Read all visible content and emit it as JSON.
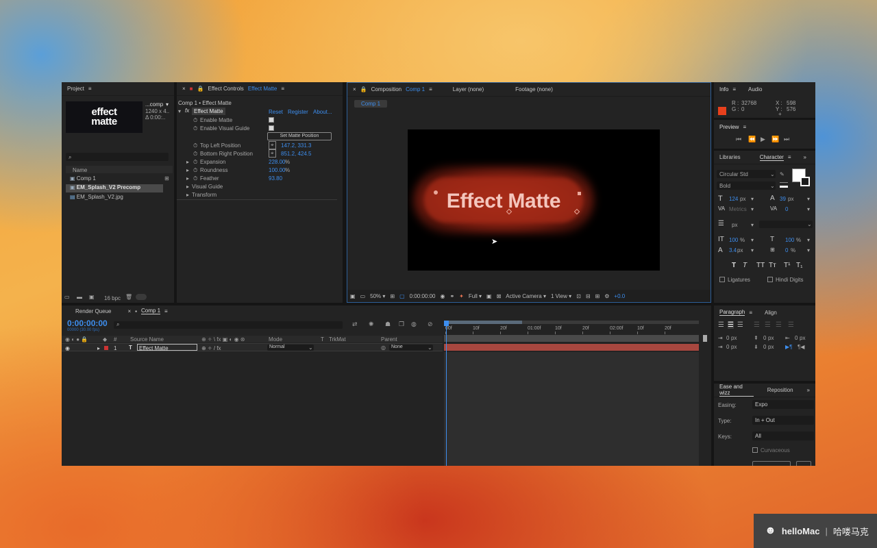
{
  "project": {
    "title": "Project",
    "thumb_line1": "effect",
    "thumb_line2": "matte",
    "thumb_caption": "...comp",
    "thumb_size": "1240 x 4..",
    "thumb_delta": "Δ 0:00:..",
    "search_icon": "magnify-icon",
    "col_name": "Name",
    "items": [
      {
        "label": "Comp 1",
        "icon": "comp-icon"
      },
      {
        "label": "EM_Splash_V2 Precomp",
        "icon": "comp-icon"
      },
      {
        "label": "EM_Splash_V2.jpg",
        "icon": "image-icon"
      }
    ],
    "bpc": "16 bpc"
  },
  "effect_controls": {
    "title_prefix": "Effect Controls",
    "title_layer": "Effect Matte",
    "breadcrumb": "Comp 1 • Effect Matte",
    "effect_name": "Effect Matte",
    "reset": "Reset",
    "register": "Register",
    "about": "About...",
    "enable_matte": "Enable Matte",
    "enable_visual_guide": "Enable Visual Guide",
    "set_matte_position": "Set Matte Position",
    "top_left": "Top Left Position",
    "top_left_value": "147.2, 331.3",
    "bottom_right": "Bottom Right Position",
    "bottom_right_value": "851.2, 424.5",
    "expansion": "Expansion",
    "expansion_value": "228.00",
    "expansion_unit": "%",
    "roundness": "Roundness",
    "roundness_value": "100.00",
    "roundness_unit": "%",
    "feather": "Feather",
    "feather_value": "93.80",
    "visual_guide": "Visual Guide",
    "transform": "Transform"
  },
  "composition": {
    "tab_prefix": "Composition",
    "tab_comp": "Comp 1",
    "layer_tab": "Layer (none)",
    "footage_tab": "Footage (none)",
    "comp_chip": "Comp 1",
    "canvas_text": "Effect Matte",
    "zoom": "50%",
    "timecode": "0:00:00:00",
    "resolution": "Full",
    "camera": "Active Camera",
    "views": "1 View",
    "exposure": "+0.0"
  },
  "info": {
    "tab_info": "Info",
    "tab_audio": "Audio",
    "r_label": "R :",
    "r_value": "32768",
    "g_label": "G :",
    "g_value": "0",
    "x_label": "X :",
    "x_value": "598",
    "y_label": "Y :",
    "y_value": "576",
    "color": "#e8401c"
  },
  "preview": {
    "title": "Preview"
  },
  "character": {
    "tab_libraries": "Libraries",
    "tab_character": "Character",
    "font": "Circular Std",
    "style": "Bold",
    "size": "124",
    "size_unit": "px",
    "leading": "39",
    "leading_unit": "px",
    "kerning": "Metrics",
    "tracking": "0",
    "stroke_unit": "px",
    "vscale": "100",
    "vscale_unit": "%",
    "hscale": "100",
    "hscale_unit": "%",
    "baseline": "3.4",
    "baseline_unit": "px",
    "tsume": "0",
    "tsume_unit": "%",
    "ligatures": "Ligatures",
    "hindi_digits": "Hindi Digits"
  },
  "paragraph": {
    "tab_paragraph": "Paragraph",
    "tab_align": "Align",
    "indent_left": "0",
    "indent_right": "0",
    "indent_first": "0",
    "space_before": "0",
    "space_after": "0",
    "unit": "px"
  },
  "ease": {
    "tab_ease": "Ease and wizz",
    "tab_reposition": "Reposition",
    "easing_label": "Easing:",
    "easing_value": "Expo",
    "type_label": "Type:",
    "type_value": "In + Out",
    "keys_label": "Keys:",
    "keys_value": "All",
    "curvaceous": "Curvaceous"
  },
  "timeline": {
    "render_queue": "Render Queue",
    "comp_tab": "Comp 1",
    "timecode": "0:00:00:00",
    "timecode_sub": "00000 (30.00 fps)",
    "col_source": "Source Name",
    "col_mode": "Mode",
    "col_t": "T",
    "col_trkmat": "TrkMat",
    "col_parent": "Parent",
    "layer_num": "1",
    "layer_name": "Effect Matte",
    "layer_mode": "Normal",
    "layer_parent": "None",
    "ruler": [
      {
        "label": "00f"
      },
      {
        "label": "10f"
      },
      {
        "label": "20f"
      },
      {
        "label": "01:00f"
      },
      {
        "label": "10f"
      },
      {
        "label": "20f"
      },
      {
        "label": "02:00f"
      },
      {
        "label": "10f"
      },
      {
        "label": "20f"
      }
    ]
  },
  "badge": {
    "brand": "helloMac",
    "sep": "|",
    "cn": "哈喽马克"
  }
}
